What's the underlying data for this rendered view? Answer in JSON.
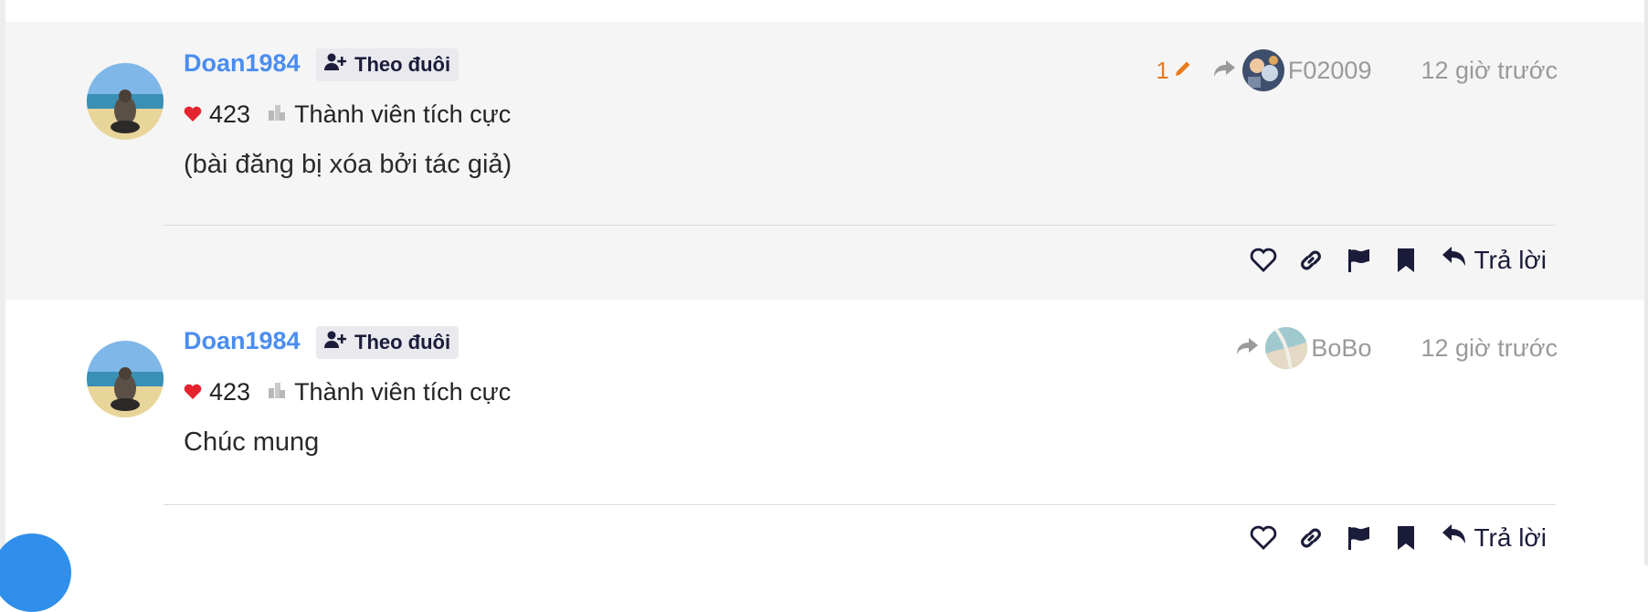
{
  "posts": [
    {
      "username": "Doan1984",
      "follow_label": "Theo đuôi",
      "likes": "423",
      "rank": "Thành viên tích cực",
      "edit_count": "1",
      "reply_to": "F02009",
      "time": "12 giờ trước",
      "content": "(bài đăng bị xóa bởi tác giả)",
      "reply_label": "Trả lời"
    },
    {
      "username": "Doan1984",
      "follow_label": "Theo đuôi",
      "likes": "423",
      "rank": "Thành viên tích cực",
      "reply_to": "BoBo",
      "time": "12 giờ trước",
      "content": "Chúc mung",
      "reply_label": "Trả lời"
    }
  ],
  "colors": {
    "username": "#4b8df0",
    "heart": "#e5232f",
    "edit": "#e87b1d",
    "muted": "#9a9a9a",
    "icon_dark": "#1b1b3a",
    "fab": "#2f8fea"
  },
  "icons": [
    "user-plus-icon",
    "heart-icon",
    "rank-icon",
    "pencil-icon",
    "reply-arrow-icon",
    "heart-outline-icon",
    "link-icon",
    "flag-icon",
    "bookmark-icon",
    "reply-icon"
  ]
}
